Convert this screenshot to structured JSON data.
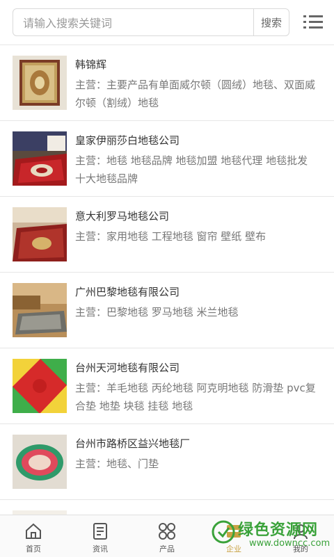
{
  "search": {
    "placeholder": "请输入搜索关键词",
    "button": "搜索"
  },
  "companies": [
    {
      "name": "韩锦辉",
      "business": "主营：主要产品有单面威尔顿（圆绒）地毯、双面威尔顿（割绒）地毯"
    },
    {
      "name": "皇家伊丽莎白地毯公司",
      "business": "主营：地毯 地毯品牌 地毯加盟 地毯代理 地毯批发 十大地毯品牌"
    },
    {
      "name": "意大利罗马地毯公司",
      "business": "主营：家用地毯 工程地毯 窗帘 壁纸 壁布"
    },
    {
      "name": "广州巴黎地毯有限公司",
      "business": "主营：巴黎地毯 罗马地毯 米兰地毯"
    },
    {
      "name": "台州天河地毯有限公司",
      "business": "主营：羊毛地毯 丙纶地毯 阿克明地毯 防滑垫 pvc复合垫 地垫 块毯 挂毯 地毯"
    },
    {
      "name": "台州市路桥区益兴地毯厂",
      "business": "主营：地毯、门垫"
    }
  ],
  "tabs": [
    {
      "label": "首页",
      "icon": "home-icon"
    },
    {
      "label": "资讯",
      "icon": "news-icon"
    },
    {
      "label": "产品",
      "icon": "grid-icon"
    },
    {
      "label": "企业",
      "icon": "company-icon"
    },
    {
      "label": "我的",
      "icon": "user-icon"
    }
  ],
  "colors": {
    "active_tab": "#c9a244",
    "watermark": "#3aa23a"
  },
  "watermark": {
    "title": "绿色资源网",
    "url": "www.downcc.com"
  }
}
